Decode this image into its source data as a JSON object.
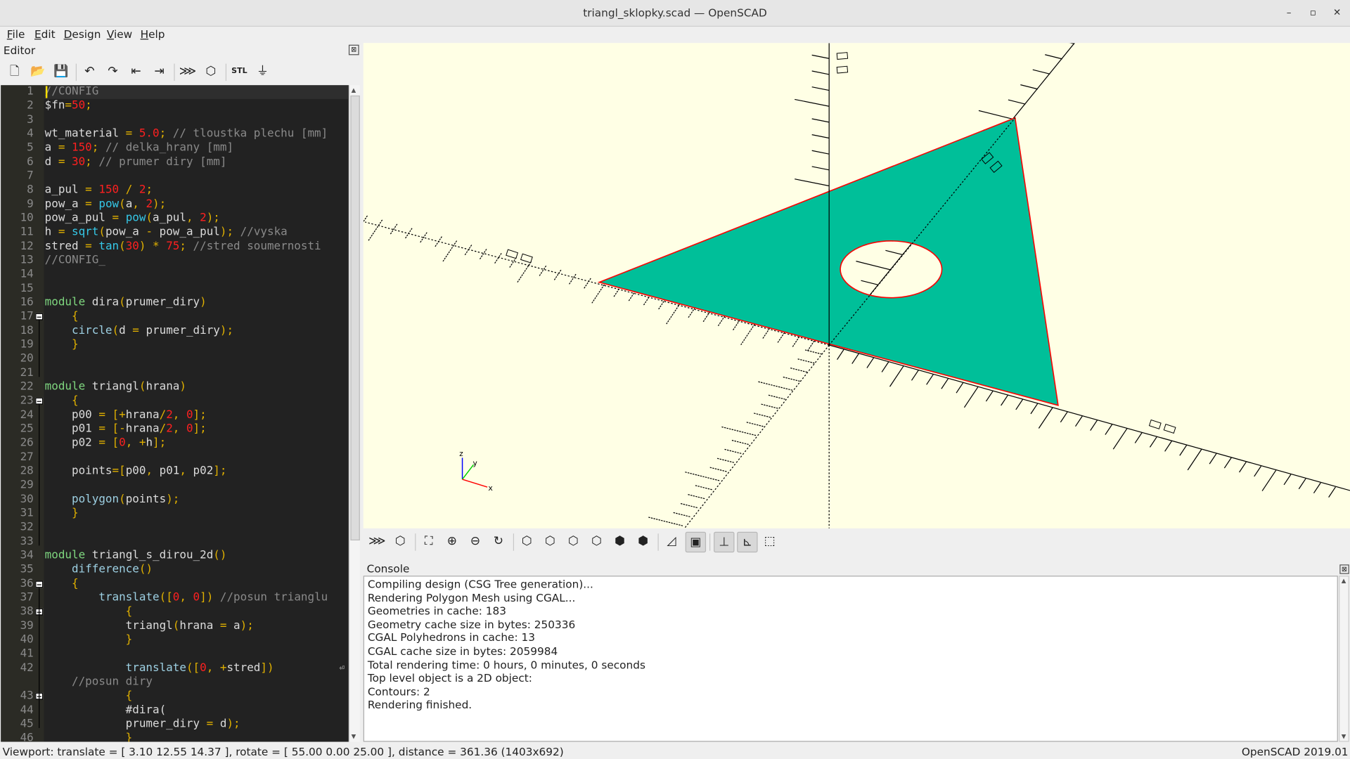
{
  "window": {
    "title": "triangl_sklopky.scad — OpenSCAD",
    "minimize": "–",
    "maximize": "▫",
    "close": "✕"
  },
  "menu": [
    "File",
    "Edit",
    "Design",
    "View",
    "Help"
  ],
  "editor": {
    "label": "Editor",
    "close": "⊠",
    "toolbar": [
      {
        "name": "new-file-icon",
        "glyph": "🗋"
      },
      {
        "name": "open-file-icon",
        "glyph": "📂"
      },
      {
        "name": "save-icon",
        "glyph": "💾"
      },
      {
        "sep": true
      },
      {
        "name": "undo-icon",
        "glyph": "↶"
      },
      {
        "name": "redo-icon",
        "glyph": "↷"
      },
      {
        "name": "unindent-icon",
        "glyph": "⇤"
      },
      {
        "name": "indent-icon",
        "glyph": "⇥"
      },
      {
        "sep": true
      },
      {
        "name": "preview-icon",
        "glyph": "⋙"
      },
      {
        "name": "render-icon",
        "glyph": "⬡"
      },
      {
        "sep": true
      },
      {
        "name": "export-stl-icon",
        "glyph": "STL"
      },
      {
        "name": "3d-print-icon",
        "glyph": "⏚"
      }
    ],
    "lines": [
      {
        "n": "1",
        "t": [
          [
            "c",
            "//CONFIG"
          ]
        ]
      },
      {
        "n": "2",
        "t": [
          [
            "t",
            "$fn"
          ],
          [
            "o",
            "="
          ],
          [
            "n",
            "50"
          ],
          [
            "o",
            ";"
          ]
        ]
      },
      {
        "n": "3",
        "t": []
      },
      {
        "n": "4",
        "t": [
          [
            "t",
            "wt_material "
          ],
          [
            "o",
            "="
          ],
          [
            "t",
            " "
          ],
          [
            "n",
            "5.0"
          ],
          [
            "o",
            ";"
          ],
          [
            "c",
            " // tloustka plechu [mm]"
          ]
        ]
      },
      {
        "n": "5",
        "t": [
          [
            "t",
            "a "
          ],
          [
            "o",
            "="
          ],
          [
            "t",
            " "
          ],
          [
            "n",
            "150"
          ],
          [
            "o",
            ";"
          ],
          [
            "c",
            " // delka_hrany [mm]"
          ]
        ]
      },
      {
        "n": "6",
        "t": [
          [
            "t",
            "d "
          ],
          [
            "o",
            "="
          ],
          [
            "t",
            " "
          ],
          [
            "n",
            "30"
          ],
          [
            "o",
            ";"
          ],
          [
            "c",
            " // prumer diry [mm]"
          ]
        ]
      },
      {
        "n": "7",
        "t": []
      },
      {
        "n": "8",
        "t": [
          [
            "t",
            "a_pul "
          ],
          [
            "o",
            "="
          ],
          [
            "t",
            " "
          ],
          [
            "n",
            "150"
          ],
          [
            "t",
            " "
          ],
          [
            "o",
            "/"
          ],
          [
            "t",
            " "
          ],
          [
            "n",
            "2"
          ],
          [
            "o",
            ";"
          ]
        ]
      },
      {
        "n": "9",
        "t": [
          [
            "t",
            "pow_a "
          ],
          [
            "o",
            "="
          ],
          [
            "t",
            " "
          ],
          [
            "f",
            "pow"
          ],
          [
            "o",
            "("
          ],
          [
            "t",
            "a"
          ],
          [
            "o",
            ","
          ],
          [
            "t",
            " "
          ],
          [
            "n",
            "2"
          ],
          [
            "o",
            ");"
          ]
        ]
      },
      {
        "n": "10",
        "t": [
          [
            "t",
            "pow_a_pul "
          ],
          [
            "o",
            "="
          ],
          [
            "t",
            " "
          ],
          [
            "f",
            "pow"
          ],
          [
            "o",
            "("
          ],
          [
            "t",
            "a_pul"
          ],
          [
            "o",
            ","
          ],
          [
            "t",
            " "
          ],
          [
            "n",
            "2"
          ],
          [
            "o",
            ");"
          ]
        ]
      },
      {
        "n": "11",
        "t": [
          [
            "t",
            "h "
          ],
          [
            "o",
            "="
          ],
          [
            "t",
            " "
          ],
          [
            "f",
            "sqrt"
          ],
          [
            "o",
            "("
          ],
          [
            "t",
            "pow_a "
          ],
          [
            "o",
            "-"
          ],
          [
            "t",
            " pow_a_pul"
          ],
          [
            "o",
            ");"
          ],
          [
            "c",
            " //vyska"
          ]
        ]
      },
      {
        "n": "12",
        "t": [
          [
            "t",
            "stred "
          ],
          [
            "o",
            "="
          ],
          [
            "t",
            " "
          ],
          [
            "f",
            "tan"
          ],
          [
            "o",
            "("
          ],
          [
            "n",
            "30"
          ],
          [
            "o",
            ")"
          ],
          [
            "t",
            " "
          ],
          [
            "o",
            "*"
          ],
          [
            "t",
            " "
          ],
          [
            "n",
            "75"
          ],
          [
            "o",
            ";"
          ],
          [
            "c",
            " //stred soumernosti"
          ]
        ]
      },
      {
        "n": "13",
        "t": [
          [
            "c",
            "//CONFIG_"
          ]
        ]
      },
      {
        "n": "14",
        "t": []
      },
      {
        "n": "15",
        "t": []
      },
      {
        "n": "16",
        "t": [
          [
            "k",
            "module"
          ],
          [
            "t",
            " dira"
          ],
          [
            "o",
            "("
          ],
          [
            "t",
            "prumer_diry"
          ],
          [
            "o",
            ")"
          ]
        ]
      },
      {
        "n": "17",
        "fold": true,
        "t": [
          [
            "t",
            "    "
          ],
          [
            "o",
            "{"
          ]
        ]
      },
      {
        "n": "18",
        "t": [
          [
            "t",
            "    "
          ],
          [
            "b",
            "circle"
          ],
          [
            "o",
            "("
          ],
          [
            "t",
            "d "
          ],
          [
            "o",
            "="
          ],
          [
            "t",
            " prumer_diry"
          ],
          [
            "o",
            ");"
          ]
        ]
      },
      {
        "n": "19",
        "t": [
          [
            "t",
            "    "
          ],
          [
            "o",
            "}"
          ]
        ]
      },
      {
        "n": "20",
        "t": []
      },
      {
        "n": "21",
        "t": []
      },
      {
        "n": "22",
        "t": [
          [
            "k",
            "module"
          ],
          [
            "t",
            " triangl"
          ],
          [
            "o",
            "("
          ],
          [
            "t",
            "hrana"
          ],
          [
            "o",
            ")"
          ]
        ]
      },
      {
        "n": "23",
        "fold": true,
        "t": [
          [
            "t",
            "    "
          ],
          [
            "o",
            "{"
          ]
        ]
      },
      {
        "n": "24",
        "t": [
          [
            "t",
            "    p00 "
          ],
          [
            "o",
            "="
          ],
          [
            "t",
            " "
          ],
          [
            "o",
            "[+"
          ],
          [
            "t",
            "hrana"
          ],
          [
            "o",
            "/"
          ],
          [
            "n",
            "2"
          ],
          [
            "o",
            ","
          ],
          [
            "t",
            " "
          ],
          [
            "n",
            "0"
          ],
          [
            "o",
            "];"
          ]
        ]
      },
      {
        "n": "25",
        "t": [
          [
            "t",
            "    p01 "
          ],
          [
            "o",
            "="
          ],
          [
            "t",
            " "
          ],
          [
            "o",
            "[-"
          ],
          [
            "t",
            "hrana"
          ],
          [
            "o",
            "/"
          ],
          [
            "n",
            "2"
          ],
          [
            "o",
            ","
          ],
          [
            "t",
            " "
          ],
          [
            "n",
            "0"
          ],
          [
            "o",
            "];"
          ]
        ]
      },
      {
        "n": "26",
        "t": [
          [
            "t",
            "    p02 "
          ],
          [
            "o",
            "="
          ],
          [
            "t",
            " "
          ],
          [
            "o",
            "["
          ],
          [
            "n",
            "0"
          ],
          [
            "o",
            ","
          ],
          [
            "t",
            " "
          ],
          [
            "o",
            "+"
          ],
          [
            "t",
            "h"
          ],
          [
            "o",
            "];"
          ]
        ]
      },
      {
        "n": "27",
        "t": []
      },
      {
        "n": "28",
        "t": [
          [
            "t",
            "    points"
          ],
          [
            "o",
            "=["
          ],
          [
            "t",
            "p00"
          ],
          [
            "o",
            ","
          ],
          [
            "t",
            " p01"
          ],
          [
            "o",
            ","
          ],
          [
            "t",
            " p02"
          ],
          [
            "o",
            "];"
          ]
        ]
      },
      {
        "n": "29",
        "t": []
      },
      {
        "n": "30",
        "t": [
          [
            "t",
            "    "
          ],
          [
            "b",
            "polygon"
          ],
          [
            "o",
            "("
          ],
          [
            "t",
            "points"
          ],
          [
            "o",
            ");"
          ]
        ]
      },
      {
        "n": "31",
        "t": [
          [
            "t",
            "    "
          ],
          [
            "o",
            "}"
          ]
        ]
      },
      {
        "n": "32",
        "t": []
      },
      {
        "n": "33",
        "t": []
      },
      {
        "n": "34",
        "t": [
          [
            "k",
            "module"
          ],
          [
            "t",
            " triangl_s_dirou_2d"
          ],
          [
            "o",
            "()"
          ]
        ]
      },
      {
        "n": "35",
        "t": [
          [
            "t",
            "    "
          ],
          [
            "b",
            "difference"
          ],
          [
            "o",
            "()"
          ]
        ]
      },
      {
        "n": "36",
        "fold": true,
        "t": [
          [
            "t",
            "    "
          ],
          [
            "o",
            "{"
          ]
        ]
      },
      {
        "n": "37",
        "t": [
          [
            "t",
            "        "
          ],
          [
            "b",
            "translate"
          ],
          [
            "o",
            "(["
          ],
          [
            "n",
            "0"
          ],
          [
            "o",
            ","
          ],
          [
            "t",
            " "
          ],
          [
            "n",
            "0"
          ],
          [
            "o",
            "])"
          ],
          [
            "c",
            " //posun trianglu"
          ]
        ]
      },
      {
        "n": "38",
        "fold": true,
        "t": [
          [
            "t",
            "            "
          ],
          [
            "o",
            "{"
          ]
        ]
      },
      {
        "n": "39",
        "t": [
          [
            "t",
            "            triangl"
          ],
          [
            "o",
            "("
          ],
          [
            "t",
            "hrana "
          ],
          [
            "o",
            "="
          ],
          [
            "t",
            " a"
          ],
          [
            "o",
            ");"
          ]
        ]
      },
      {
        "n": "40",
        "t": [
          [
            "t",
            "            "
          ],
          [
            "o",
            "}"
          ]
        ]
      },
      {
        "n": "41",
        "t": []
      },
      {
        "n": "42",
        "wrap": true,
        "t": [
          [
            "t",
            "            "
          ],
          [
            "b",
            "translate"
          ],
          [
            "o",
            "(["
          ],
          [
            "n",
            "0"
          ],
          [
            "o",
            ","
          ],
          [
            "t",
            " "
          ],
          [
            "o",
            "+"
          ],
          [
            "t",
            "stred"
          ],
          [
            "o",
            "])"
          ]
        ]
      },
      {
        "n": "",
        "t": [
          [
            "c",
            "    //posun diry"
          ]
        ]
      },
      {
        "n": "43",
        "fold": true,
        "t": [
          [
            "t",
            "            "
          ],
          [
            "o",
            "{"
          ]
        ]
      },
      {
        "n": "44",
        "t": [
          [
            "t",
            "            #dira("
          ]
        ]
      },
      {
        "n": "45",
        "t": [
          [
            "t",
            "            prumer_diry "
          ],
          [
            "o",
            "="
          ],
          [
            "t",
            " d"
          ],
          [
            "o",
            ");"
          ]
        ]
      },
      {
        "n": "46",
        "t": [
          [
            "t",
            "            "
          ],
          [
            "o",
            "}"
          ]
        ]
      }
    ]
  },
  "viewer": {
    "background": "#ffffe5",
    "shape_fill": "#00bf99",
    "shape_edge": "#ff0000",
    "axis_labels": {
      "x": "x",
      "y": "y",
      "z": "z"
    },
    "toolbar": [
      {
        "name": "preview-icon",
        "glyph": "⋙"
      },
      {
        "name": "render-icon",
        "glyph": "⬡"
      },
      {
        "sep": true
      },
      {
        "name": "view-all-icon",
        "glyph": "⛶"
      },
      {
        "name": "zoom-in-icon",
        "glyph": "⊕"
      },
      {
        "name": "zoom-out-icon",
        "glyph": "⊖"
      },
      {
        "name": "reset-view-icon",
        "glyph": "↻"
      },
      {
        "sep": true
      },
      {
        "name": "view-right-icon",
        "glyph": "⬡"
      },
      {
        "name": "view-top-icon",
        "glyph": "⬡"
      },
      {
        "name": "view-bottom-icon",
        "glyph": "⬡"
      },
      {
        "name": "view-left-icon",
        "glyph": "⬡"
      },
      {
        "name": "view-front-icon",
        "glyph": "⬢"
      },
      {
        "name": "view-back-icon",
        "glyph": "⬢"
      },
      {
        "sep": true
      },
      {
        "name": "perspective-icon",
        "glyph": "◿"
      },
      {
        "name": "orthogonal-icon",
        "glyph": "▣",
        "active": true
      },
      {
        "sep": true
      },
      {
        "name": "show-axes-icon",
        "glyph": "⊥",
        "active": true
      },
      {
        "name": "show-scale-markers-icon",
        "glyph": "⊾",
        "active": true
      },
      {
        "name": "show-edges-icon",
        "glyph": "⬚"
      }
    ]
  },
  "console": {
    "label": "Console",
    "close": "⊠",
    "lines": [
      "Compiling design (CSG Tree generation)...",
      "Rendering Polygon Mesh using CGAL...",
      "Geometries in cache: 183",
      "Geometry cache size in bytes: 250336",
      "CGAL Polyhedrons in cache: 13",
      "CGAL cache size in bytes: 2059984",
      "Total rendering time: 0 hours, 0 minutes, 0 seconds",
      "Top level object is a 2D object:",
      "Contours: 2",
      "Rendering finished."
    ]
  },
  "status": {
    "viewport": "Viewport: translate = [ 3.10 12.55 14.37 ], rotate = [ 55.00 0.00 25.00 ], distance = 361.36 (1403x692)",
    "version": "OpenSCAD 2019.01"
  }
}
